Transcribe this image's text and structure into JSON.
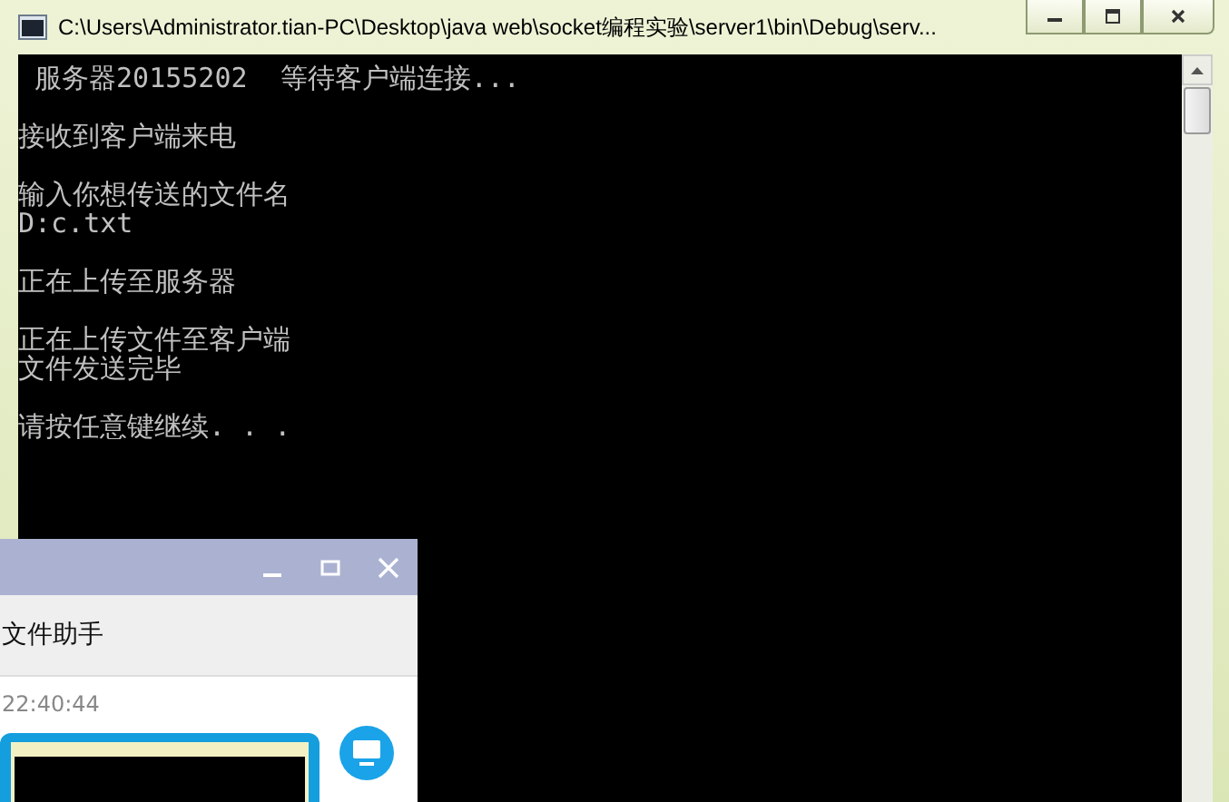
{
  "window": {
    "title": "C:\\Users\\Administrator.tian-PC\\Desktop\\java web\\socket编程实验\\server1\\bin\\Debug\\serv..."
  },
  "console": {
    "paragraphs": [
      {
        "lines": [
          " 服务器20155202  等待客户端连接..."
        ]
      },
      {
        "lines": [
          "接收到客户端来电"
        ]
      },
      {
        "lines": [
          "输入你想传送的文件名",
          "D:c.txt"
        ]
      },
      {
        "lines": [
          "正在上传至服务器"
        ]
      },
      {
        "lines": [
          "正在上传文件至客户端",
          "文件发送完毕"
        ]
      },
      {
        "lines": [
          "请按任意键继续. . ."
        ]
      }
    ]
  },
  "chat_window": {
    "title": "文件助手",
    "time": "22:40:44"
  }
}
